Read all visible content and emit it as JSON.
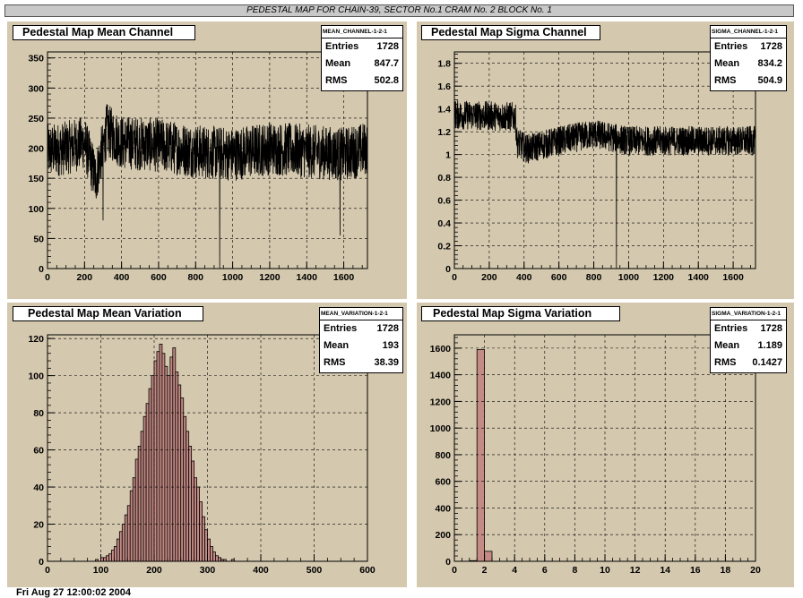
{
  "banner": "PEDESTAL MAP FOR CHAIN-39, SECTOR No.1 CRAM No. 2 BLOCK No. 1",
  "footer": "Fri Aug 27 12:00:02 2004",
  "colors": {
    "pad_bg": "#d4c8ae",
    "hist_fill": "#c48a84",
    "line": "#000000"
  },
  "chart_data": [
    {
      "type": "line",
      "title": "Pedestal Map Mean Channel",
      "stats": {
        "name": "MEAN_CHANNEL-1-2-1",
        "entries": "1728",
        "mean": "847.7",
        "rms": "502.8"
      },
      "xlim": [
        0,
        1728
      ],
      "ylim": [
        0,
        360
      ],
      "xticks": [
        0,
        200,
        400,
        600,
        800,
        1000,
        1200,
        1400,
        1600
      ],
      "yticks": [
        0,
        50,
        100,
        150,
        200,
        250,
        300,
        350
      ],
      "grid": true,
      "noise": {
        "n": 1728,
        "profile": [
          [
            0,
            195
          ],
          [
            100,
            200
          ],
          [
            200,
            210
          ],
          [
            260,
            150
          ],
          [
            320,
            230
          ],
          [
            400,
            210
          ],
          [
            600,
            205
          ],
          [
            800,
            195
          ],
          [
            1000,
            190
          ],
          [
            1200,
            200
          ],
          [
            1400,
            195
          ],
          [
            1600,
            190
          ],
          [
            1728,
            200
          ]
        ],
        "spread": 45,
        "dips": [
          [
            930,
            0
          ],
          [
            300,
            80
          ],
          [
            1580,
            55
          ]
        ]
      }
    },
    {
      "type": "line",
      "title": "Pedestal Map Sigma Channel",
      "stats": {
        "name": "SIGMA_CHANNEL-1-2-1",
        "entries": "1728",
        "mean": "834.2",
        "rms": "504.9"
      },
      "xlim": [
        0,
        1728
      ],
      "ylim": [
        0,
        1.9
      ],
      "xticks": [
        0,
        200,
        400,
        600,
        800,
        1000,
        1200,
        1400,
        1600
      ],
      "yticks": [
        0,
        0.2,
        0.4,
        0.6,
        0.8,
        1,
        1.2,
        1.4,
        1.6,
        1.8
      ],
      "grid": true,
      "noise": {
        "n": 1728,
        "profile": [
          [
            0,
            1.35
          ],
          [
            350,
            1.33
          ],
          [
            360,
            1.1
          ],
          [
            420,
            1.05
          ],
          [
            600,
            1.12
          ],
          [
            800,
            1.18
          ],
          [
            1000,
            1.12
          ],
          [
            1728,
            1.12
          ]
        ],
        "spread": 0.13,
        "dips": [
          [
            930,
            0
          ]
        ]
      }
    },
    {
      "type": "bar",
      "title": "Pedestal Map Mean Variation",
      "stats": {
        "name": "MEAN_VARIATION-1-2-1",
        "entries": "1728",
        "mean": "193",
        "rms": "38.39"
      },
      "xlim": [
        0,
        600
      ],
      "ylim": [
        0,
        122
      ],
      "xticks": [
        0,
        100,
        200,
        300,
        400,
        500,
        600
      ],
      "yticks": [
        0,
        20,
        40,
        60,
        80,
        100,
        120
      ],
      "grid": true,
      "bin_start": 90,
      "bin_width": 5,
      "values": [
        1,
        0,
        2,
        2,
        3,
        4,
        6,
        8,
        12,
        16,
        20,
        25,
        30,
        38,
        45,
        55,
        62,
        70,
        78,
        85,
        93,
        100,
        108,
        113,
        117,
        112,
        105,
        100,
        110,
        115,
        102,
        95,
        88,
        78,
        70,
        62,
        54,
        45,
        40,
        32,
        24,
        17,
        12,
        8,
        5,
        3,
        2,
        1,
        1,
        0,
        0,
        1
      ]
    },
    {
      "type": "bar",
      "title": "Pedestal Map Sigma Variation",
      "stats": {
        "name": "SIGMA_VARIATION-1-2-1",
        "entries": "1728",
        "mean": "1.189",
        "rms": "0.1427"
      },
      "xlim": [
        0,
        20
      ],
      "ylim": [
        0,
        1700
      ],
      "xticks": [
        0,
        2,
        4,
        6,
        8,
        10,
        12,
        14,
        16,
        18,
        20
      ],
      "yticks": [
        0,
        200,
        400,
        600,
        800,
        1000,
        1200,
        1400,
        1600
      ],
      "grid": true,
      "bin_start": 0,
      "bin_width": 0.5,
      "values": [
        0,
        0,
        5,
        1590,
        75,
        0
      ]
    }
  ]
}
